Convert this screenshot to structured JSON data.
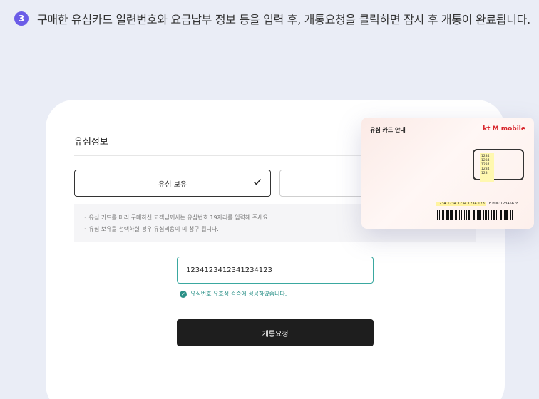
{
  "step": {
    "number": "3",
    "text": "구매한 유심카드 일련번호와 요금납부 정보 등을 입력 후, 개통요청을 클릭하면 잠시 후 개통이 완료됩니다."
  },
  "form": {
    "section_title": "유심정보",
    "option_own": "유심 보유",
    "option_other": "",
    "notices": [
      "유심 카드를 미리 구매하신 고객님께서는 유심번호 19자리를 입력해 주세요.",
      "유심 보유를 선택하실 경우 유심비용이 미 청구 됩니다."
    ],
    "serial_value": "1234123412341234123",
    "valid_message": "유심번호 유효성 검증에 성공하였습니다.",
    "submit_label": "개통요청"
  },
  "sim_guide": {
    "title": "유심 카드 안내",
    "brand_kt": "kt",
    "brand_mobile": "M mobile",
    "chip_lines": [
      "1234",
      "1234",
      "1234",
      "1234",
      "123"
    ],
    "serial_highlight": "1234 1234 1234 1234 123",
    "serial_suffix": "F PUK:12345678"
  },
  "colors": {
    "accent": "#6b5ce7",
    "valid": "#2a9087",
    "button": "#1e1e1e"
  }
}
